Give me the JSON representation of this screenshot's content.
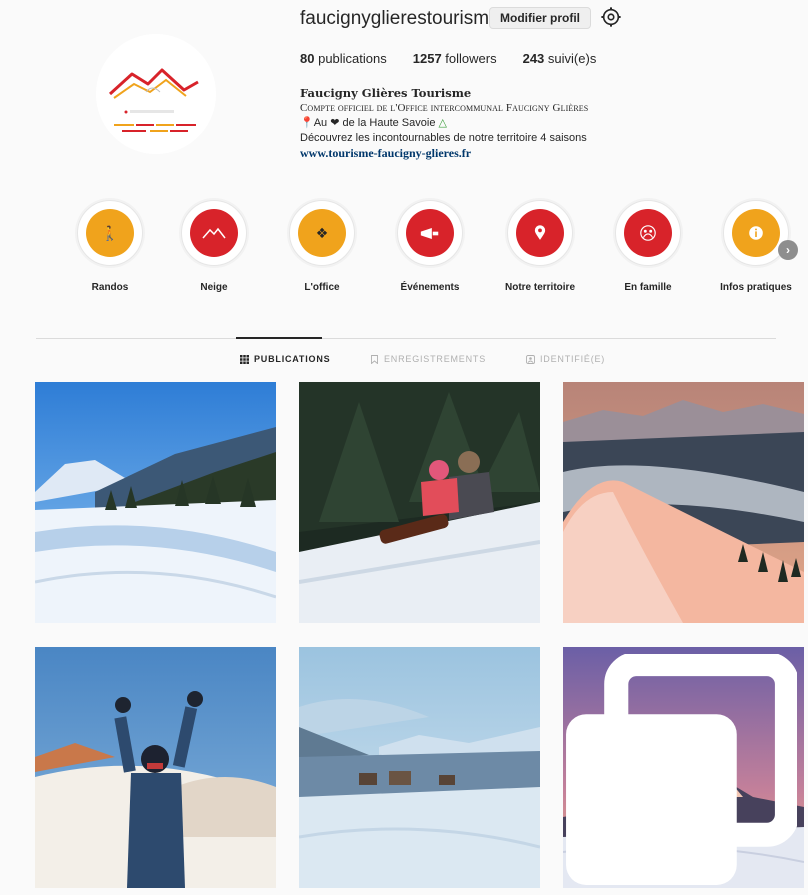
{
  "profile": {
    "username": "faucignyglierestourisme",
    "edit_label": "Modifier profil",
    "stats": {
      "posts_count": "80",
      "posts_label": "publications",
      "followers_count": "1257",
      "followers_label": "followers",
      "following_count": "243",
      "following_label": "suivi(e)s"
    },
    "bio": {
      "full_name": "Faucigny Glières Tourisme",
      "category": "Compte officiel de l'Office intercommunal Faucigny Glières",
      "line1": "Au ❤ de la Haute Savoie",
      "line2": "Découvrez les incontournables de notre territoire 4 saisons",
      "website": "www.tourisme-faucigny-glieres.fr"
    },
    "avatar_icon": "faucigny-glieres-logo"
  },
  "highlights": [
    {
      "label": "Randos",
      "color": "#f0a31c",
      "icon": "hiking-icon"
    },
    {
      "label": "Neige",
      "color": "#d8232a",
      "icon": "mountain-icon"
    },
    {
      "label": "L'office",
      "color": "#f0a31c",
      "icon": "puzzle-icon"
    },
    {
      "label": "Événements",
      "color": "#d8232a",
      "icon": "megaphone-icon"
    },
    {
      "label": "Notre territoire",
      "color": "#d8232a",
      "icon": "location-pin-icon"
    },
    {
      "label": "En famille",
      "color": "#d8232a",
      "icon": "family-icon"
    },
    {
      "label": "Infos pratiques",
      "color": "#f0a31c",
      "icon": "info-icon"
    }
  ],
  "tabs": [
    {
      "label": "PUBLICATIONS",
      "icon": "grid-icon",
      "active": true
    },
    {
      "label": "ENREGISTREMENTS",
      "icon": "bookmark-icon",
      "active": false
    },
    {
      "label": "IDENTIFIÉ(E)",
      "icon": "tag-icon",
      "active": false
    }
  ],
  "posts": [
    {
      "icon": "snowy-valley-photo"
    },
    {
      "icon": "sledding-children-photo"
    },
    {
      "icon": "sunset-ridge-photo"
    },
    {
      "icon": "child-in-snow-photo"
    },
    {
      "icon": "snowy-village-photo"
    },
    {
      "icon": "sunset-mountain-photo",
      "multi": true
    }
  ],
  "colors": {
    "accent_orange": "#f0a31c",
    "accent_red": "#d8232a",
    "link": "#00376b"
  }
}
